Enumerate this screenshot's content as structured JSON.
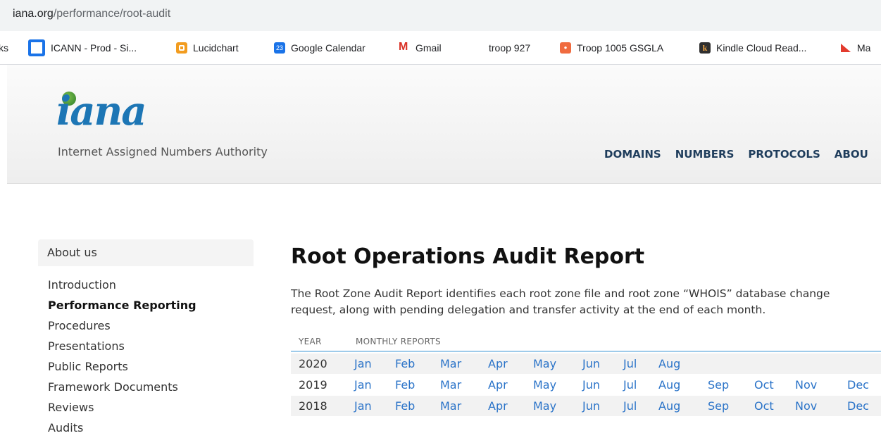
{
  "browser": {
    "url_host": "iana.org",
    "url_path": "/performance/root-audit"
  },
  "bookmarks": [
    {
      "label": "ks",
      "icon": "none"
    },
    {
      "label": "ICANN - Prod - Si...",
      "icon": "icann-icon"
    },
    {
      "label": "Lucidchart",
      "icon": "lucidchart-icon"
    },
    {
      "label": "Google Calendar",
      "icon": "google-calendar-icon",
      "icon_text": "23"
    },
    {
      "label": "Gmail",
      "icon": "gmail-icon",
      "icon_text": "M"
    },
    {
      "label": "troop 927",
      "icon": "none"
    },
    {
      "label": "Troop 1005 GSGLA",
      "icon": "troop-icon"
    },
    {
      "label": "Kindle Cloud Read...",
      "icon": "kindle-icon",
      "icon_text": "k"
    },
    {
      "label": "Ma",
      "icon": "bookmark-icon"
    }
  ],
  "site": {
    "logo_text": "iana",
    "tagline": "Internet Assigned Numbers Authority",
    "nav": [
      "DOMAINS",
      "NUMBERS",
      "PROTOCOLS",
      "ABOU"
    ]
  },
  "sidebar": {
    "heading": "About us",
    "items": [
      {
        "label": "Introduction",
        "active": false
      },
      {
        "label": "Performance Reporting",
        "active": true
      },
      {
        "label": "Procedures",
        "active": false
      },
      {
        "label": "Presentations",
        "active": false
      },
      {
        "label": "Public Reports",
        "active": false
      },
      {
        "label": "Framework Documents",
        "active": false
      },
      {
        "label": "Reviews",
        "active": false
      },
      {
        "label": "Audits",
        "active": false
      }
    ]
  },
  "main": {
    "title": "Root Operations Audit Report",
    "intro": "The Root Zone Audit Report identifies each root zone file and root zone “WHOIS” database change request, along with pending delegation and transfer activity at the end of each month.",
    "columns": {
      "year": "YEAR",
      "reports": "MONTHLY REPORTS"
    },
    "rows": [
      {
        "year": "2020",
        "months": [
          "Jan",
          "Feb",
          "Mar",
          "Apr",
          "May",
          "Jun",
          "Jul",
          "Aug"
        ]
      },
      {
        "year": "2019",
        "months": [
          "Jan",
          "Feb",
          "Mar",
          "Apr",
          "May",
          "Jun",
          "Jul",
          "Aug",
          "Sep",
          "Oct",
          "Nov",
          "Dec"
        ]
      },
      {
        "year": "2018",
        "months": [
          "Jan",
          "Feb",
          "Mar",
          "Apr",
          "May",
          "Jun",
          "Jul",
          "Aug",
          "Sep",
          "Oct",
          "Nov",
          "Dec"
        ]
      }
    ]
  },
  "colors": {
    "link": "#2a73c8",
    "nav": "#1f3d5c",
    "table_rule": "#9ecbea"
  }
}
